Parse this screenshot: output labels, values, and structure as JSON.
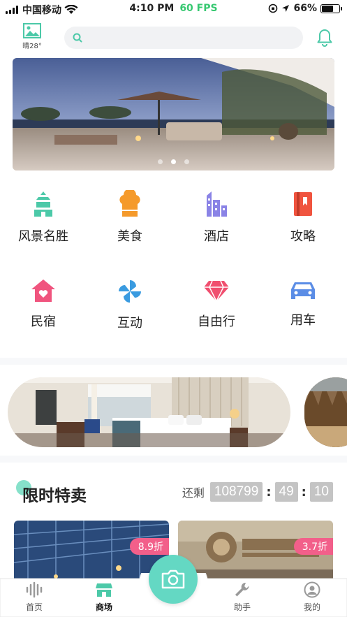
{
  "status_bar": {
    "carrier": "中国移动",
    "time": "4:10 PM",
    "fps": "60 FPS",
    "battery": "66%",
    "battery_level": 0.66
  },
  "header": {
    "weather": "晴28°",
    "search_placeholder": ""
  },
  "banner": {
    "dots": 3,
    "active_dot": 1
  },
  "categories": [
    {
      "label": "风景名胜",
      "icon": "pagoda-icon",
      "color": "#4cc9a8"
    },
    {
      "label": "美食",
      "icon": "chef-hat-icon",
      "color": "#f59a2b"
    },
    {
      "label": "酒店",
      "icon": "buildings-icon",
      "color": "#8a83e6"
    },
    {
      "label": "攻略",
      "icon": "guidebook-icon",
      "color": "#f0543f"
    },
    {
      "label": "民宿",
      "icon": "house-heart-icon",
      "color": "#f0547e"
    },
    {
      "label": "互动",
      "icon": "pinwheel-icon",
      "color": "#3a9be0"
    },
    {
      "label": "自由行",
      "icon": "diamond-icon",
      "color": "#f04f6f"
    },
    {
      "label": "用车",
      "icon": "car-icon",
      "color": "#5b8de6"
    }
  ],
  "flash_sale": {
    "title": "限时特卖",
    "remaining_label": "还剩",
    "hours": "108799",
    "minutes": "49",
    "seconds": "10"
  },
  "products": [
    {
      "discount": "8.9折"
    },
    {
      "discount": "3.7折"
    }
  ],
  "tabbar": {
    "items": [
      {
        "label": "首页",
        "icon": "sound-wave-icon"
      },
      {
        "label": "商场",
        "icon": "store-icon"
      },
      {
        "label": "助手",
        "icon": "wrench-icon"
      },
      {
        "label": "我的",
        "icon": "user-icon"
      }
    ],
    "active": "商场"
  },
  "colors": {
    "accent": "#64d8c3",
    "discount_badge": "#f25f8a",
    "fps": "#37c871"
  }
}
